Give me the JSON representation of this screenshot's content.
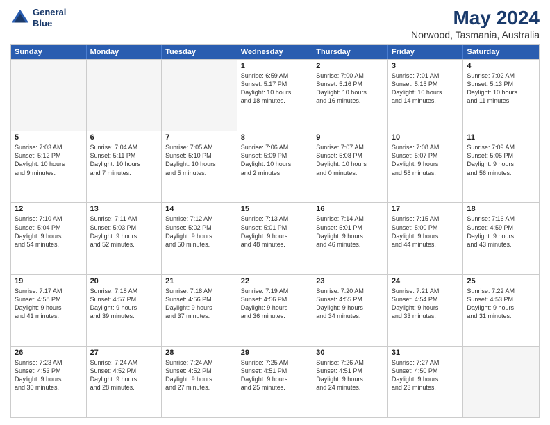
{
  "header": {
    "logo_line1": "General",
    "logo_line2": "Blue",
    "title": "May 2024",
    "subtitle": "Norwood, Tasmania, Australia"
  },
  "days": [
    "Sunday",
    "Monday",
    "Tuesday",
    "Wednesday",
    "Thursday",
    "Friday",
    "Saturday"
  ],
  "rows": [
    [
      {
        "day": "",
        "empty": true
      },
      {
        "day": "",
        "empty": true
      },
      {
        "day": "",
        "empty": true
      },
      {
        "day": "1",
        "lines": [
          "Sunrise: 6:59 AM",
          "Sunset: 5:17 PM",
          "Daylight: 10 hours",
          "and 18 minutes."
        ]
      },
      {
        "day": "2",
        "lines": [
          "Sunrise: 7:00 AM",
          "Sunset: 5:16 PM",
          "Daylight: 10 hours",
          "and 16 minutes."
        ]
      },
      {
        "day": "3",
        "lines": [
          "Sunrise: 7:01 AM",
          "Sunset: 5:15 PM",
          "Daylight: 10 hours",
          "and 14 minutes."
        ]
      },
      {
        "day": "4",
        "lines": [
          "Sunrise: 7:02 AM",
          "Sunset: 5:13 PM",
          "Daylight: 10 hours",
          "and 11 minutes."
        ]
      }
    ],
    [
      {
        "day": "5",
        "lines": [
          "Sunrise: 7:03 AM",
          "Sunset: 5:12 PM",
          "Daylight: 10 hours",
          "and 9 minutes."
        ]
      },
      {
        "day": "6",
        "lines": [
          "Sunrise: 7:04 AM",
          "Sunset: 5:11 PM",
          "Daylight: 10 hours",
          "and 7 minutes."
        ]
      },
      {
        "day": "7",
        "lines": [
          "Sunrise: 7:05 AM",
          "Sunset: 5:10 PM",
          "Daylight: 10 hours",
          "and 5 minutes."
        ]
      },
      {
        "day": "8",
        "lines": [
          "Sunrise: 7:06 AM",
          "Sunset: 5:09 PM",
          "Daylight: 10 hours",
          "and 2 minutes."
        ]
      },
      {
        "day": "9",
        "lines": [
          "Sunrise: 7:07 AM",
          "Sunset: 5:08 PM",
          "Daylight: 10 hours",
          "and 0 minutes."
        ]
      },
      {
        "day": "10",
        "lines": [
          "Sunrise: 7:08 AM",
          "Sunset: 5:07 PM",
          "Daylight: 9 hours",
          "and 58 minutes."
        ]
      },
      {
        "day": "11",
        "lines": [
          "Sunrise: 7:09 AM",
          "Sunset: 5:05 PM",
          "Daylight: 9 hours",
          "and 56 minutes."
        ]
      }
    ],
    [
      {
        "day": "12",
        "lines": [
          "Sunrise: 7:10 AM",
          "Sunset: 5:04 PM",
          "Daylight: 9 hours",
          "and 54 minutes."
        ]
      },
      {
        "day": "13",
        "lines": [
          "Sunrise: 7:11 AM",
          "Sunset: 5:03 PM",
          "Daylight: 9 hours",
          "and 52 minutes."
        ]
      },
      {
        "day": "14",
        "lines": [
          "Sunrise: 7:12 AM",
          "Sunset: 5:02 PM",
          "Daylight: 9 hours",
          "and 50 minutes."
        ]
      },
      {
        "day": "15",
        "lines": [
          "Sunrise: 7:13 AM",
          "Sunset: 5:01 PM",
          "Daylight: 9 hours",
          "and 48 minutes."
        ]
      },
      {
        "day": "16",
        "lines": [
          "Sunrise: 7:14 AM",
          "Sunset: 5:01 PM",
          "Daylight: 9 hours",
          "and 46 minutes."
        ]
      },
      {
        "day": "17",
        "lines": [
          "Sunrise: 7:15 AM",
          "Sunset: 5:00 PM",
          "Daylight: 9 hours",
          "and 44 minutes."
        ]
      },
      {
        "day": "18",
        "lines": [
          "Sunrise: 7:16 AM",
          "Sunset: 4:59 PM",
          "Daylight: 9 hours",
          "and 43 minutes."
        ]
      }
    ],
    [
      {
        "day": "19",
        "lines": [
          "Sunrise: 7:17 AM",
          "Sunset: 4:58 PM",
          "Daylight: 9 hours",
          "and 41 minutes."
        ]
      },
      {
        "day": "20",
        "lines": [
          "Sunrise: 7:18 AM",
          "Sunset: 4:57 PM",
          "Daylight: 9 hours",
          "and 39 minutes."
        ]
      },
      {
        "day": "21",
        "lines": [
          "Sunrise: 7:18 AM",
          "Sunset: 4:56 PM",
          "Daylight: 9 hours",
          "and 37 minutes."
        ]
      },
      {
        "day": "22",
        "lines": [
          "Sunrise: 7:19 AM",
          "Sunset: 4:56 PM",
          "Daylight: 9 hours",
          "and 36 minutes."
        ]
      },
      {
        "day": "23",
        "lines": [
          "Sunrise: 7:20 AM",
          "Sunset: 4:55 PM",
          "Daylight: 9 hours",
          "and 34 minutes."
        ]
      },
      {
        "day": "24",
        "lines": [
          "Sunrise: 7:21 AM",
          "Sunset: 4:54 PM",
          "Daylight: 9 hours",
          "and 33 minutes."
        ]
      },
      {
        "day": "25",
        "lines": [
          "Sunrise: 7:22 AM",
          "Sunset: 4:53 PM",
          "Daylight: 9 hours",
          "and 31 minutes."
        ]
      }
    ],
    [
      {
        "day": "26",
        "lines": [
          "Sunrise: 7:23 AM",
          "Sunset: 4:53 PM",
          "Daylight: 9 hours",
          "and 30 minutes."
        ]
      },
      {
        "day": "27",
        "lines": [
          "Sunrise: 7:24 AM",
          "Sunset: 4:52 PM",
          "Daylight: 9 hours",
          "and 28 minutes."
        ]
      },
      {
        "day": "28",
        "lines": [
          "Sunrise: 7:24 AM",
          "Sunset: 4:52 PM",
          "Daylight: 9 hours",
          "and 27 minutes."
        ]
      },
      {
        "day": "29",
        "lines": [
          "Sunrise: 7:25 AM",
          "Sunset: 4:51 PM",
          "Daylight: 9 hours",
          "and 25 minutes."
        ]
      },
      {
        "day": "30",
        "lines": [
          "Sunrise: 7:26 AM",
          "Sunset: 4:51 PM",
          "Daylight: 9 hours",
          "and 24 minutes."
        ]
      },
      {
        "day": "31",
        "lines": [
          "Sunrise: 7:27 AM",
          "Sunset: 4:50 PM",
          "Daylight: 9 hours",
          "and 23 minutes."
        ]
      },
      {
        "day": "",
        "empty": true
      }
    ]
  ]
}
